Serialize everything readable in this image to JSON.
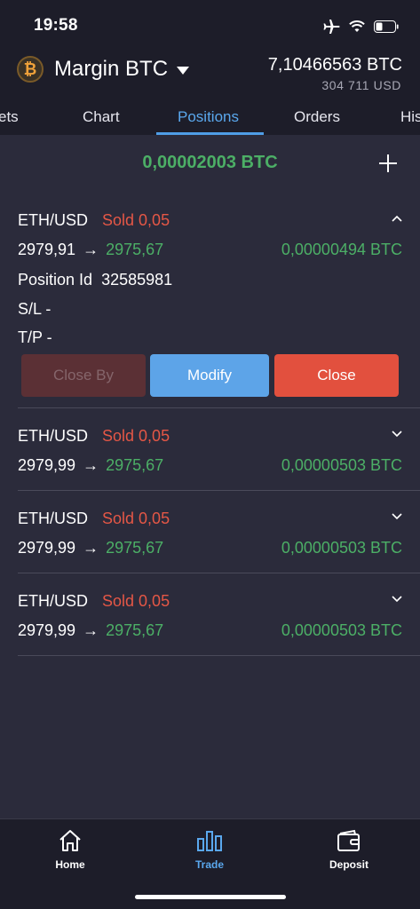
{
  "status": {
    "time": "19:58"
  },
  "account": {
    "coin_symbol": "₿",
    "name": "Margin BTC",
    "balance_btc": "7,10466563 BTC",
    "balance_usd": "304 711  USD"
  },
  "tabs": [
    {
      "label": "ets"
    },
    {
      "label": "Chart"
    },
    {
      "label": "Positions",
      "active": true
    },
    {
      "label": "Orders"
    },
    {
      "label": "His"
    }
  ],
  "summary": {
    "total_pnl": "0,00002003 BTC"
  },
  "positions": [
    {
      "symbol": "ETH/USD",
      "side": "Sold 0,05",
      "open_price": "2979,91",
      "arrow": "→",
      "current_price": "2975,67",
      "pnl": "0,00000494 BTC",
      "expanded": true,
      "position_id_label": "Position Id",
      "position_id": "32585981",
      "sl": "S/L -",
      "tp": "T/P -"
    },
    {
      "symbol": "ETH/USD",
      "side": "Sold 0,05",
      "open_price": "2979,99",
      "arrow": "→",
      "current_price": "2975,67",
      "pnl": "0,00000503 BTC"
    },
    {
      "symbol": "ETH/USD",
      "side": "Sold 0,05",
      "open_price": "2979,99",
      "arrow": "→",
      "current_price": "2975,67",
      "pnl": "0,00000503 BTC"
    },
    {
      "symbol": "ETH/USD",
      "side": "Sold 0,05",
      "open_price": "2979,99",
      "arrow": "→",
      "current_price": "2975,67",
      "pnl": "0,00000503 BTC"
    }
  ],
  "actions": {
    "close_by": "Close By",
    "modify": "Modify",
    "close": "Close"
  },
  "nav": {
    "home": "Home",
    "trade": "Trade",
    "deposit": "Deposit"
  },
  "colors": {
    "accent": "#5aa8ee",
    "profit": "#4caf66",
    "sell": "#e55746",
    "background": "#2b2b3b",
    "bar": "#1d1d29"
  },
  "icons": [
    "airplane-icon",
    "wifi-icon",
    "battery-icon",
    "bitcoin-icon",
    "chevron-up-icon",
    "chevron-down-icon",
    "plus-icon",
    "home-icon",
    "trade-chart-icon",
    "wallet-icon"
  ]
}
